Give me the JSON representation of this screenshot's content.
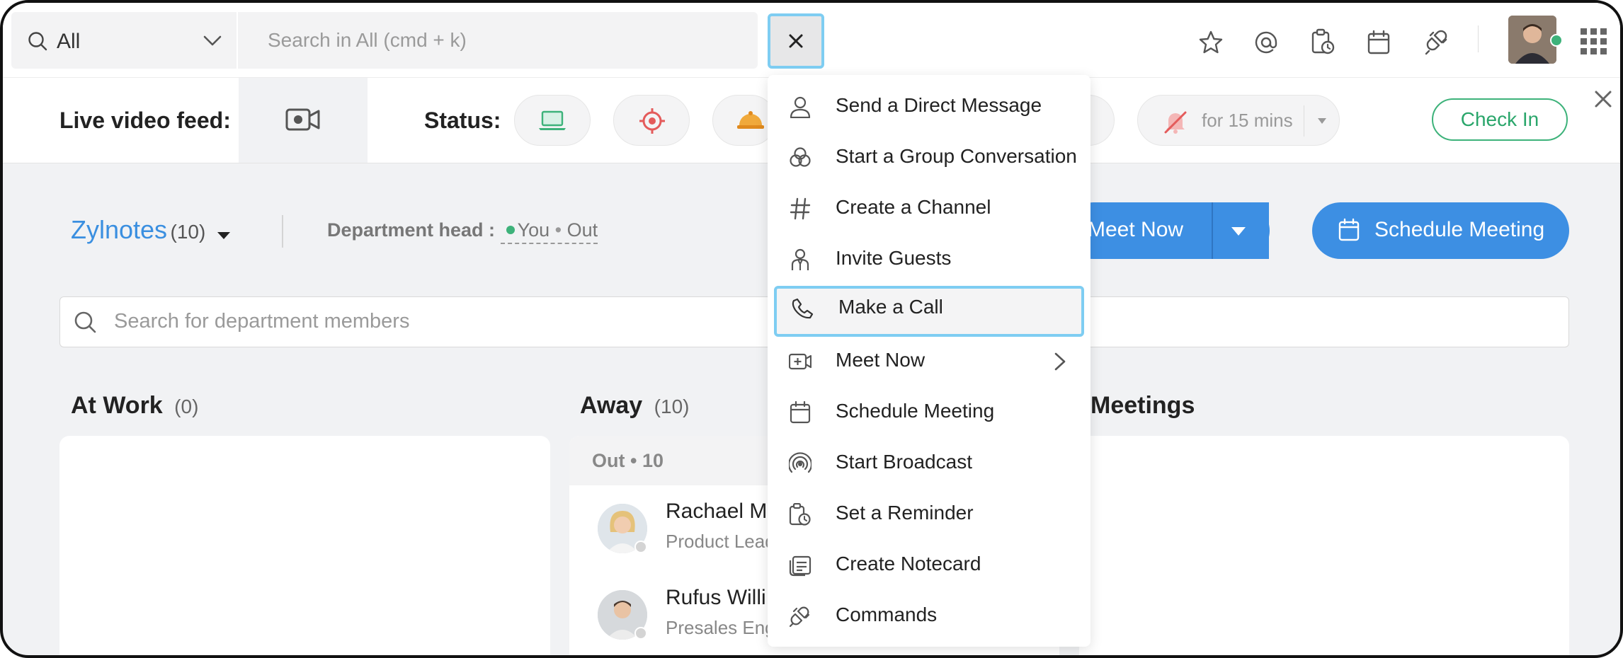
{
  "search": {
    "scope": "All",
    "placeholder": "Search in All (cmd + k)"
  },
  "statusbar": {
    "live_video_label": "Live video feed:",
    "status_label": "Status:",
    "dnd_duration": "for 15 mins",
    "checkin_label": "Check In"
  },
  "department": {
    "name": "Zylnotes",
    "count": "(10)",
    "head_label": "Department head :",
    "head_value": "You",
    "head_sep": "•",
    "head_status": "Out",
    "meet_now_label": "Meet Now",
    "schedule_label": "Schedule Meeting",
    "member_search_placeholder": "Search for department members"
  },
  "columns": {
    "at_work": {
      "title": "At Work",
      "count": "(0)"
    },
    "away": {
      "title": "Away",
      "count": "(10)",
      "group": "Out • 10"
    },
    "meetings": {
      "title": "Meetings"
    }
  },
  "members": [
    {
      "name": "Rachael Ma",
      "role": "Product Lead"
    },
    {
      "name": "Rufus Willi",
      "role": "Presales Eng"
    }
  ],
  "menu": {
    "items": [
      {
        "label": "Send a Direct Message",
        "icon": "user-icon"
      },
      {
        "label": "Start a Group Conversation",
        "icon": "group-icon"
      },
      {
        "label": "Create a Channel",
        "icon": "hash-icon"
      },
      {
        "label": "Invite Guests",
        "icon": "guest-icon"
      },
      {
        "label": "Make a Call",
        "icon": "phone-icon"
      },
      {
        "label": "Meet Now",
        "icon": "video-plus-icon"
      },
      {
        "label": "Schedule Meeting",
        "icon": "calendar-icon"
      },
      {
        "label": "Start Broadcast",
        "icon": "broadcast-icon"
      },
      {
        "label": "Set a Reminder",
        "icon": "reminder-icon"
      },
      {
        "label": "Create Notecard",
        "icon": "notecard-icon"
      },
      {
        "label": "Commands",
        "icon": "plug-icon"
      }
    ]
  },
  "colors": {
    "accent": "#3d8fe3",
    "highlight": "#7ecdf2",
    "checkin": "#3db27a",
    "online": "#3db27a"
  }
}
